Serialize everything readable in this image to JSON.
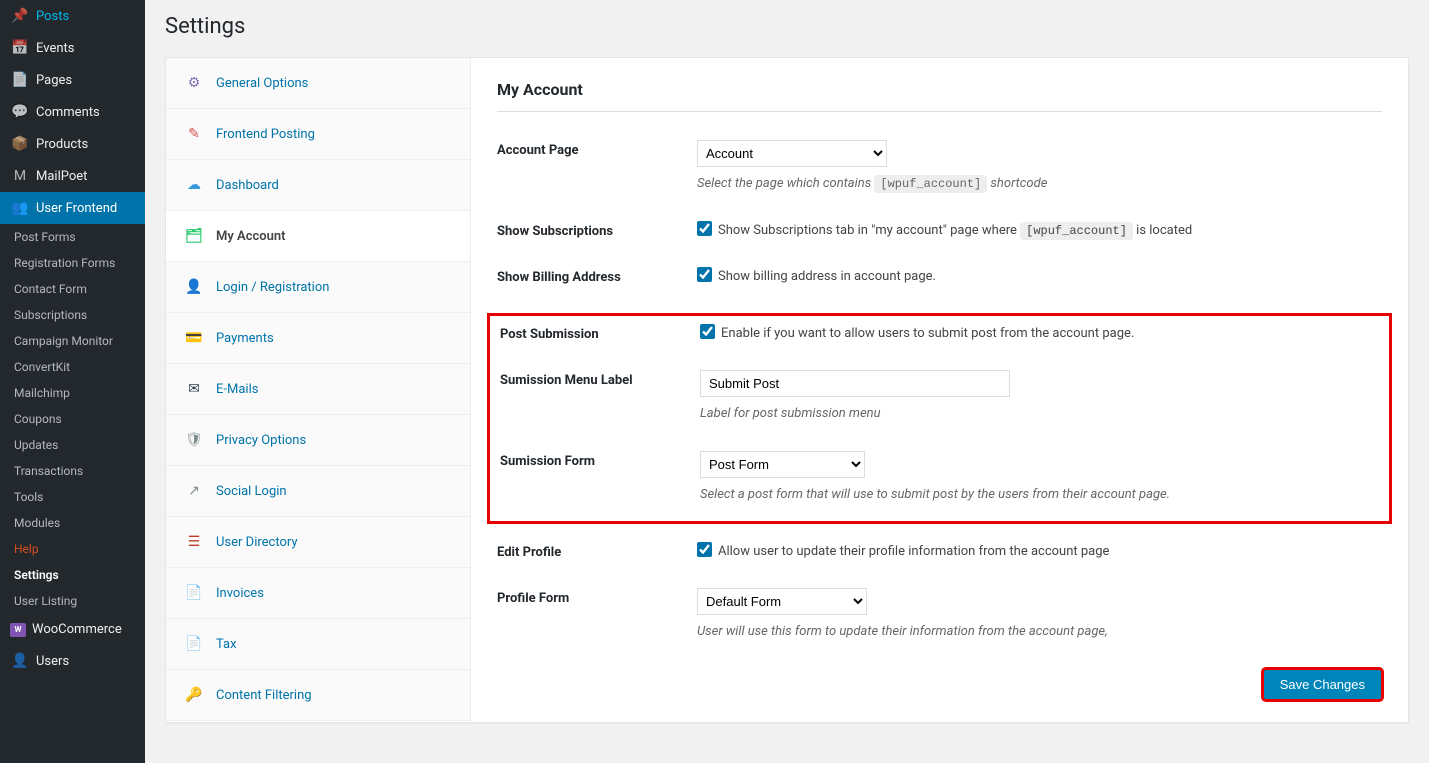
{
  "page_title": "Settings",
  "admin_menu": {
    "items": [
      {
        "icon": "📌",
        "label": "Posts"
      },
      {
        "icon": "📅",
        "label": "Events"
      },
      {
        "icon": "📄",
        "label": "Pages"
      },
      {
        "icon": "💬",
        "label": "Comments"
      },
      {
        "icon": "📦",
        "label": "Products"
      },
      {
        "icon": "M",
        "label": "MailPoet"
      }
    ],
    "active_label": "User Frontend",
    "subs": [
      "Post Forms",
      "Registration Forms",
      "Contact Form",
      "Subscriptions",
      "Campaign Monitor",
      "ConvertKit",
      "Mailchimp",
      "Coupons",
      "Updates",
      "Transactions",
      "Tools",
      "Modules",
      "Help",
      "Settings",
      "User Listing"
    ],
    "woocommerce_label": "WooCommerce",
    "users_label": "Users"
  },
  "settings_tabs": [
    {
      "icon": "⚙",
      "label": "General Options",
      "color": "c-purple"
    },
    {
      "icon": "✎",
      "label": "Frontend Posting",
      "color": "c-red"
    },
    {
      "icon": "☁",
      "label": "Dashboard",
      "color": "c-blue"
    },
    {
      "icon": "🗂",
      "label": "My Account",
      "color": "c-green",
      "active": true
    },
    {
      "icon": "👤",
      "label": "Login / Registration",
      "color": "c-teal"
    },
    {
      "icon": "💳",
      "label": "Payments",
      "color": "c-orange"
    },
    {
      "icon": "✉",
      "label": "E-Mails",
      "color": "c-navy"
    },
    {
      "icon": "🛡",
      "label": "Privacy Options",
      "color": "c-gray"
    },
    {
      "icon": "↗",
      "label": "Social Login",
      "color": "c-gray"
    },
    {
      "icon": "☰",
      "label": "User Directory",
      "color": "c-redd"
    },
    {
      "icon": "📄",
      "label": "Invoices",
      "color": "c-lime"
    },
    {
      "icon": "📄",
      "label": "Tax",
      "color": "c-gray"
    },
    {
      "icon": "🔑",
      "label": "Content Filtering",
      "color": "c-gray"
    }
  ],
  "section_title": "My Account",
  "rows": {
    "account_page": {
      "label": "Account Page",
      "value": "Account",
      "desc_before": "Select the page which contains ",
      "code": "[wpuf_account]",
      "desc_after": " shortcode"
    },
    "show_subscriptions": {
      "label": "Show Subscriptions",
      "chk_before": "Show Subscriptions tab in \"my account\" page where ",
      "code": "[wpuf_account]",
      "chk_after": " is located",
      "checked": true
    },
    "show_billing": {
      "label": "Show Billing Address",
      "chk_text": "Show billing address in account page.",
      "checked": true
    },
    "post_submission": {
      "label": "Post Submission",
      "chk_text": "Enable if you want to allow users to submit post from the account page.",
      "checked": true
    },
    "submission_label": {
      "label": "Sumission Menu Label",
      "value": "Submit Post",
      "desc": "Label for post submission menu"
    },
    "submission_form": {
      "label": "Sumission Form",
      "value": "Post Form",
      "desc": "Select a post form that will use to submit post by the users from their account page."
    },
    "edit_profile": {
      "label": "Edit Profile",
      "chk_text": "Allow user to update their profile information from the account page",
      "checked": true
    },
    "profile_form": {
      "label": "Profile Form",
      "value": "Default Form",
      "desc": "User will use this form to update their information from the account page,"
    }
  },
  "save_label": "Save Changes"
}
